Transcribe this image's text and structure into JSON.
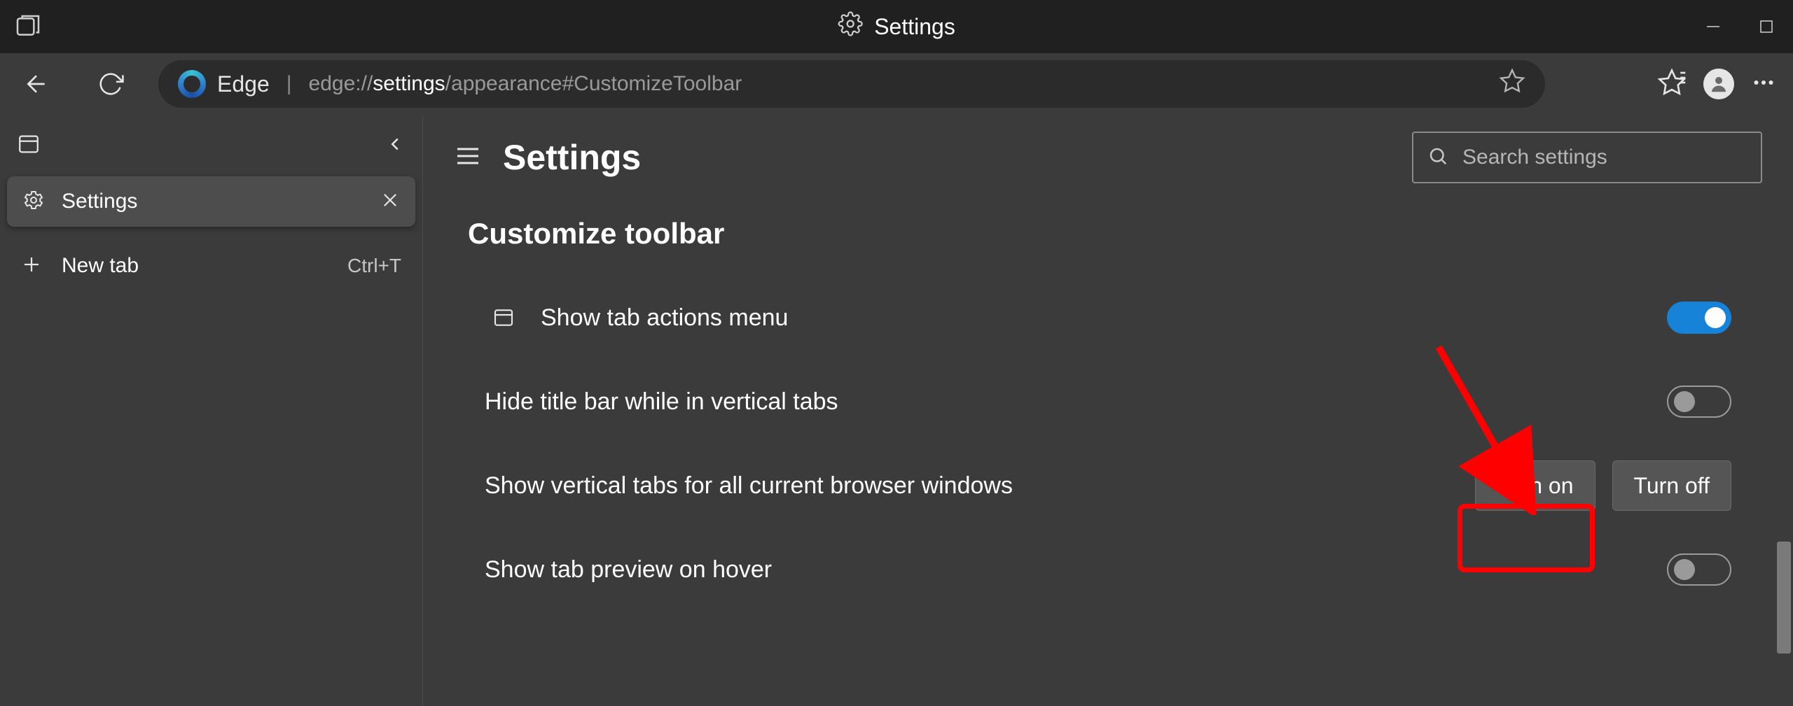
{
  "window": {
    "title": "Settings"
  },
  "nav": {
    "app_name": "Edge",
    "url_prefix": "edge://",
    "url_strong": "settings",
    "url_suffix": "/appearance#CustomizeToolbar"
  },
  "sidebar": {
    "active_tab": {
      "label": "Settings"
    },
    "new_tab": {
      "label": "New tab",
      "shortcut": "Ctrl+T"
    }
  },
  "settings": {
    "page_title": "Settings",
    "search_placeholder": "Search settings",
    "section_title": "Customize toolbar",
    "rows": [
      {
        "label": "Show tab actions menu",
        "type": "toggle",
        "on": true,
        "has_icon": true
      },
      {
        "label": "Hide title bar while in vertical tabs",
        "type": "toggle",
        "on": false
      },
      {
        "label": "Show vertical tabs for all current browser windows",
        "type": "buttons",
        "turn_on": "Turn on",
        "turn_off": "Turn off"
      },
      {
        "label": "Show tab preview on hover",
        "type": "toggle",
        "on": false
      }
    ]
  }
}
